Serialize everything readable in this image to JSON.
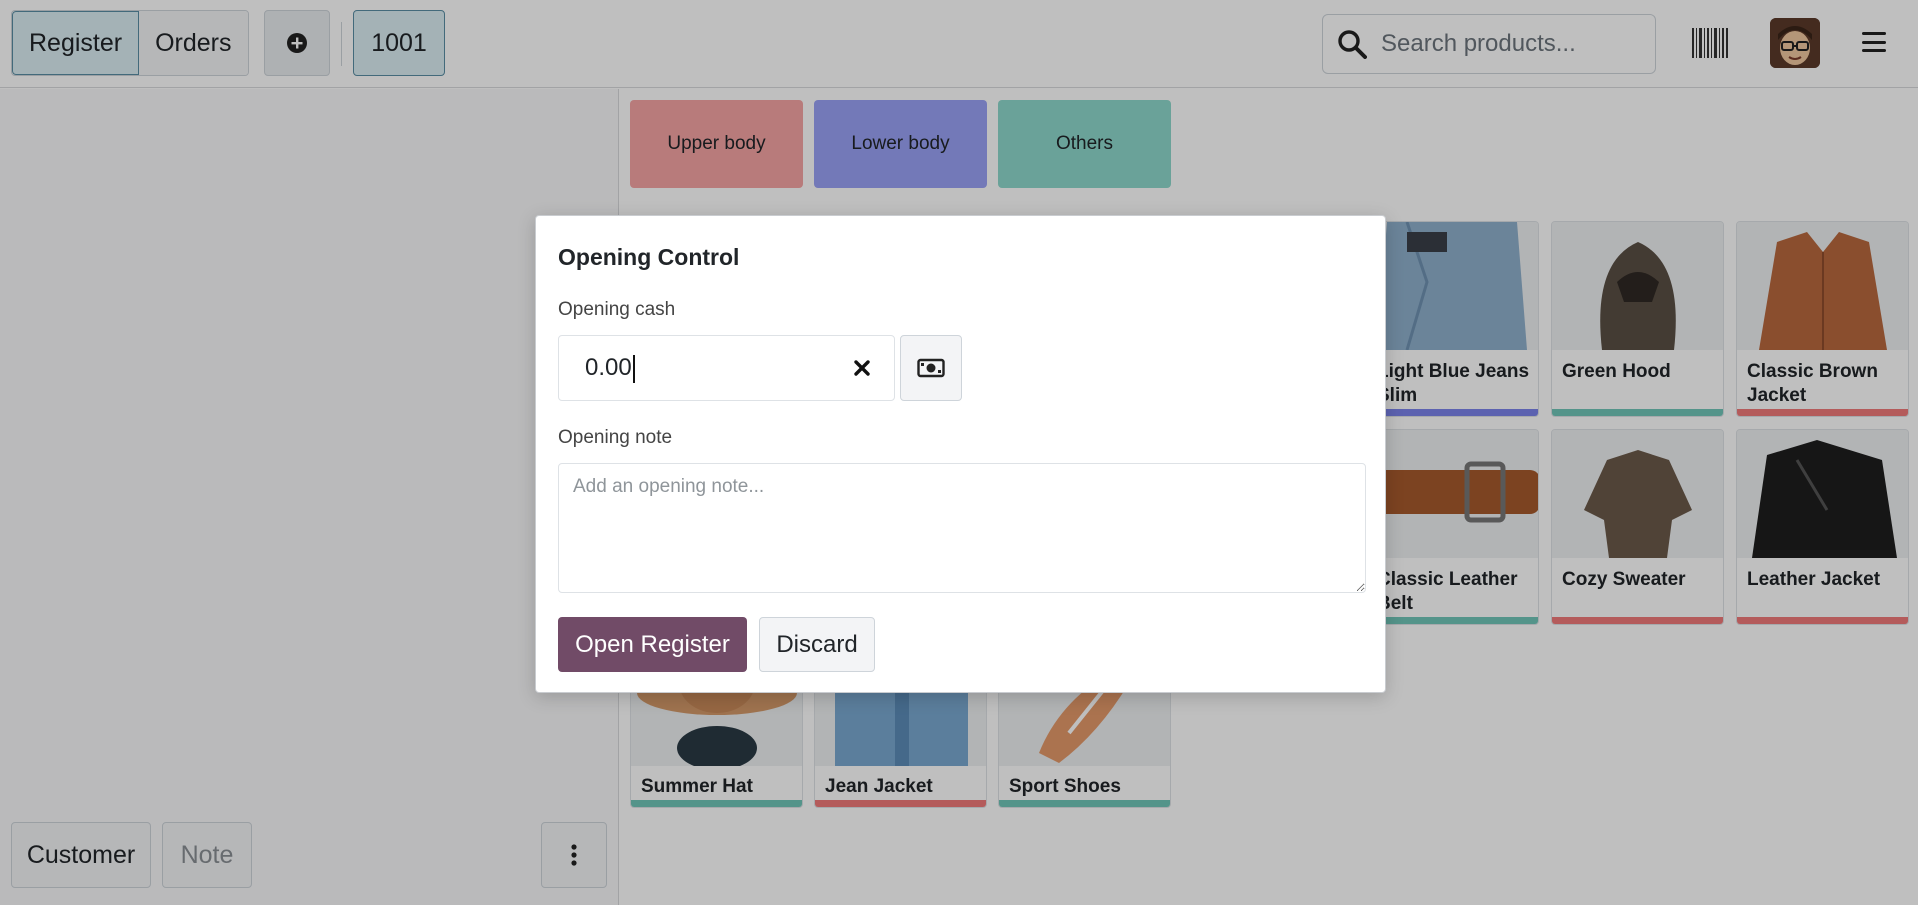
{
  "topbar": {
    "nav": [
      "Register",
      "Orders"
    ],
    "active_nav": "Register",
    "order_number": "1001",
    "search_placeholder": "Search products..."
  },
  "sidebar": {
    "customer_label": "Customer",
    "note_label": "Note"
  },
  "categories": [
    {
      "label": "Upper body",
      "color": "#f6a4a4"
    },
    {
      "label": "Lower body",
      "color": "#9aa2f6"
    },
    {
      "label": "Others",
      "color": "#8ed9cc"
    }
  ],
  "products": [
    {
      "name": "Light Blue Jeans Slim",
      "bar_color": "#7b83eb"
    },
    {
      "name": "Green Hood",
      "bar_color": "#70c6b8"
    },
    {
      "name": "Classic Brown Jacket",
      "bar_color": "#f07a7a"
    },
    {
      "name": "Classic Leather Belt",
      "bar_color": "#70c6b8"
    },
    {
      "name": "Cozy Sweater",
      "bar_color": "#f07a7a"
    },
    {
      "name": "Leather Jacket",
      "bar_color": "#f07a7a"
    },
    {
      "name": "Summer Hat",
      "bar_color": "#70c6b8"
    },
    {
      "name": "Jean Jacket",
      "bar_color": "#f07a7a"
    },
    {
      "name": "Sport Shoes",
      "bar_color": "#70c6b8"
    }
  ],
  "modal": {
    "title": "Opening Control",
    "cash_label": "Opening cash",
    "cash_value": "0.00",
    "note_label": "Opening note",
    "note_placeholder": "Add an opening note...",
    "open_button": "Open Register",
    "discard_button": "Discard"
  },
  "colors": {
    "primary": "#714b67",
    "active_tab_bg": "#dbeef3"
  }
}
